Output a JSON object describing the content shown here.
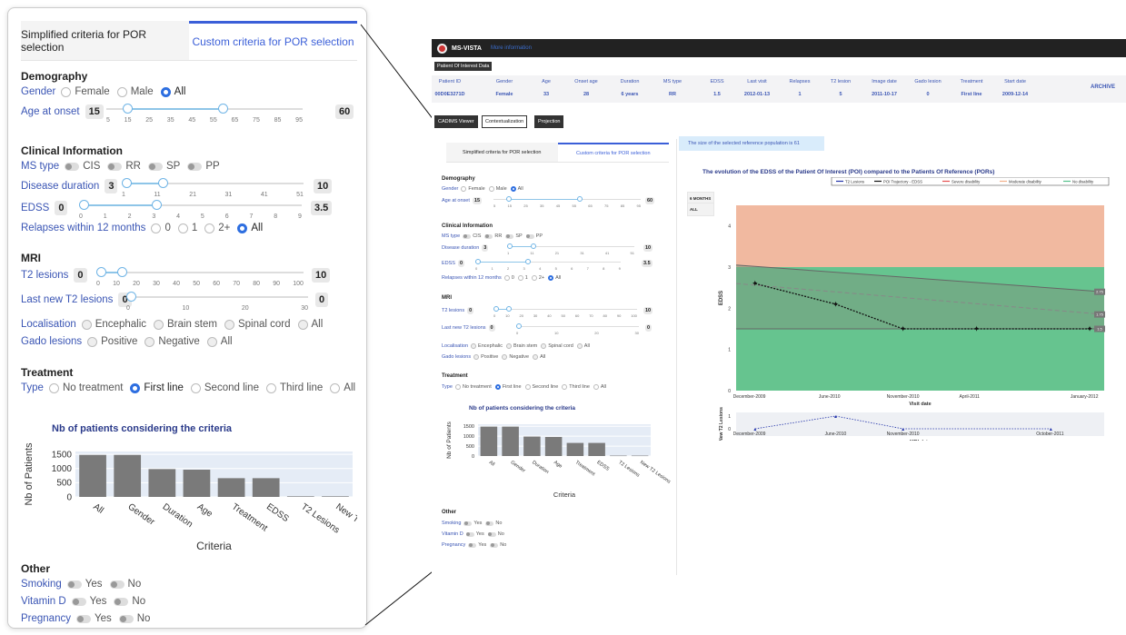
{
  "zoom": {
    "tabs": [
      "Simplified criteria for POR selection",
      "Custom criteria for POR selection"
    ],
    "demography": {
      "title": "Demography",
      "gender_label": "Gender",
      "gender_options": [
        "Female",
        "Male",
        "All"
      ],
      "gender_selected": "All",
      "age_label": "Age at onset",
      "age_min": "15",
      "age_max": "60",
      "age_ticks": [
        "5",
        "15",
        "25",
        "35",
        "45",
        "55",
        "65",
        "75",
        "85",
        "95"
      ]
    },
    "clinical": {
      "title": "Clinical Information",
      "ms_label": "MS type",
      "ms_options": [
        "CIS",
        "RR",
        "SP",
        "PP"
      ],
      "duration_label": "Disease duration",
      "duration_min": "3",
      "duration_max": "10",
      "duration_ticks": [
        "1",
        "11",
        "21",
        "31",
        "41",
        "51"
      ],
      "edss_label": "EDSS",
      "edss_min": "0",
      "edss_max": "3.5",
      "edss_ticks": [
        "0",
        "1",
        "2",
        "3",
        "4",
        "5",
        "6",
        "7",
        "8",
        "9"
      ],
      "relapses_label": "Relapses within 12 months",
      "relapses_options": [
        "0",
        "1",
        "2+",
        "All"
      ],
      "relapses_selected": "All"
    },
    "mri": {
      "title": "MRI",
      "t2_label": "T2 lesions",
      "t2_min": "0",
      "t2_max": "10",
      "t2_ticks": [
        "0",
        "10",
        "20",
        "30",
        "40",
        "50",
        "60",
        "70",
        "80",
        "90",
        "100"
      ],
      "new_t2_label": "Last new T2 lesions",
      "new_t2_min": "0",
      "new_t2_max": "0",
      "new_t2_ticks": [
        "0",
        "10",
        "20",
        "30"
      ],
      "localisation_label": "Localisation",
      "localisation_options": [
        "Encephalic",
        "Brain stem",
        "Spinal cord",
        "All"
      ],
      "gado_label": "Gado lesions",
      "gado_options": [
        "Positive",
        "Negative",
        "All"
      ]
    },
    "treatment": {
      "title": "Treatment",
      "type_label": "Type",
      "type_options": [
        "No treatment",
        "First line",
        "Second line",
        "Third line",
        "All"
      ],
      "type_selected": "First line"
    },
    "other": {
      "title": "Other",
      "smoking_label": "Smoking",
      "vitamin_label": "Vitamin D",
      "pregnancy_label": "Pregnancy",
      "yes": "Yes",
      "no": "No"
    }
  },
  "chart_data": [
    {
      "type": "bar",
      "title": "Nb of patients considering the criteria",
      "xlabel": "Criteria",
      "ylabel": "Nb of Patients",
      "categories": [
        "All",
        "Gender",
        "Duration",
        "Age",
        "Treatment",
        "EDSS",
        "T2 Lesions",
        "New T2 Lesions"
      ],
      "values": [
        1480,
        1480,
        980,
        960,
        660,
        660,
        20,
        20
      ],
      "ylim": [
        0,
        1600
      ],
      "yticks": [
        "0",
        "500",
        "1000",
        "1500"
      ]
    },
    {
      "type": "line",
      "title": "The evolution of the EDSS of the Patient Of Interest (POI) compared to the Patients Of Reference (PORs)",
      "xlabel": "Visit date",
      "ylabel": "EDSS",
      "x_ticks": [
        "December-2009",
        "June-2010",
        "November-2010",
        "April-2011",
        "January-2012"
      ],
      "y_ticks": [
        "0",
        "1",
        "2",
        "3",
        "4"
      ],
      "ylim": [
        0,
        4.5
      ],
      "legend": [
        "T2 Lesions",
        "POI Trajectory - EDSS",
        "Severe disability",
        "Moderate disability",
        "No disability"
      ],
      "series": [
        {
          "name": "POI Trajectory - EDSS",
          "x": [
            "2009-12-14",
            "2010-06-15",
            "2010-11-15",
            "2011-05-01",
            "2012-01-13"
          ],
          "values": [
            2.6,
            2.1,
            1.5,
            1.5,
            1.5
          ]
        }
      ],
      "right_tags": [
        "2.75",
        "1.75",
        "1.5"
      ]
    },
    {
      "type": "line",
      "xlabel": "MRI date",
      "ylabel": "New T2 Lesions",
      "x_ticks": [
        "December-2009",
        "June-2010",
        "November-2010",
        "October-2011"
      ],
      "y_ticks": [
        "0",
        "1"
      ],
      "series": [
        {
          "name": "T2 Lesions",
          "x": [
            "2009-12-14",
            "2010-06-15",
            "2010-11-15",
            "2011-10-17"
          ],
          "values": [
            0,
            1,
            0,
            0
          ]
        }
      ]
    }
  ],
  "app": {
    "name": "MS-VISTA",
    "more": "More information",
    "poi_tag": "Patient Of Interest Data",
    "headers": [
      "Patient ID",
      "Gender",
      "Age",
      "Onset age",
      "Duration",
      "MS type",
      "EDSS",
      "Last visit",
      "Relapses",
      "T2 lesion",
      "Image date",
      "Gado lesion",
      "Treatment",
      "Start date"
    ],
    "values": [
      "00D0E3271D",
      "Female",
      "33",
      "28",
      "6 years",
      "RR",
      "1.5",
      "2012-01-13",
      "1",
      "5",
      "2011-10-17",
      "0",
      "First line",
      "2009-12-14"
    ],
    "archive": "ARCHIVE",
    "view_tabs": [
      "CADIMS Viewer",
      "Contextualization",
      "Projection"
    ],
    "info": "The size of the selected reference population is 61",
    "range_buttons": [
      "6 MONTHS",
      "ALL"
    ]
  }
}
